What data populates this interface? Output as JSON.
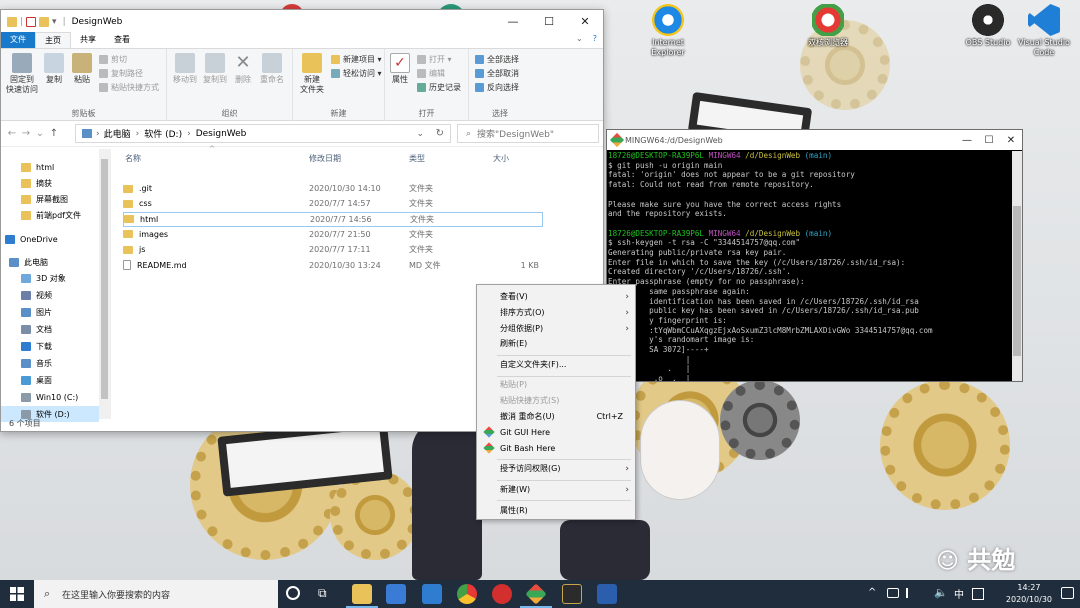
{
  "desktop": {
    "icons": [
      {
        "label": "Internet Explorer",
        "color": "#1e88e5"
      },
      {
        "label": "双核浏览器",
        "color": "#e53935"
      },
      {
        "label": "OBS Studio",
        "color": "#2a2a2a"
      },
      {
        "label": "Visual Studio Code",
        "color": "#1f7ed6"
      }
    ],
    "watermark": "共勉"
  },
  "explorer": {
    "title": "DesignWeb",
    "tabs": [
      "文件",
      "主页",
      "共享",
      "查看"
    ],
    "ribbon": {
      "clipboard": {
        "pin": "固定到\n快速访问",
        "copy": "复制",
        "paste": "粘贴",
        "cut": "剪切",
        "copy_path": "复制路径",
        "paste_shortcut": "粘贴快捷方式",
        "group": "剪贴板"
      },
      "organize": {
        "move_to": "移动到",
        "copy_to": "复制到",
        "delete": "删除",
        "rename": "重命名",
        "group": "组织"
      },
      "new": {
        "new_folder": "新建\n文件夹",
        "new_item": "新建项目 ▾",
        "easy_access": "轻松访问 ▾",
        "group": "新建"
      },
      "open": {
        "properties": "属性",
        "open": "打开 ▾",
        "edit": "编辑",
        "history": "历史记录",
        "group": "打开"
      },
      "select": {
        "select_all": "全部选择",
        "select_none": "全部取消",
        "invert": "反向选择",
        "group": "选择"
      }
    },
    "address": {
      "segments": [
        "此电脑",
        "软件 (D:)",
        "DesignWeb"
      ],
      "search_placeholder": "搜索\"DesignWeb\""
    },
    "nav": [
      {
        "label": "html",
        "kind": "folder"
      },
      {
        "label": "摘获",
        "kind": "folder"
      },
      {
        "label": "屏幕截图",
        "kind": "folder"
      },
      {
        "label": "前端pdf文件",
        "kind": "folder"
      },
      {
        "label": "OneDrive",
        "kind": "cloud"
      },
      {
        "label": "此电脑",
        "kind": "pc"
      },
      {
        "label": "3D 对象",
        "kind": "3d"
      },
      {
        "label": "视频",
        "kind": "video"
      },
      {
        "label": "图片",
        "kind": "pic"
      },
      {
        "label": "文档",
        "kind": "doc"
      },
      {
        "label": "下载",
        "kind": "down"
      },
      {
        "label": "音乐",
        "kind": "music"
      },
      {
        "label": "桌面",
        "kind": "desk"
      },
      {
        "label": "Win10 (C:)",
        "kind": "drive"
      },
      {
        "label": "软件 (D:)",
        "kind": "drive"
      }
    ],
    "columns": [
      "名称",
      "修改日期",
      "类型",
      "大小"
    ],
    "files": [
      {
        "name": ".git",
        "date": "2020/10/30 14:10",
        "type": "文件夹",
        "size": ""
      },
      {
        "name": "css",
        "date": "2020/7/7 14:57",
        "type": "文件夹",
        "size": ""
      },
      {
        "name": "html",
        "date": "2020/7/7 14:56",
        "type": "文件夹",
        "size": ""
      },
      {
        "name": "images",
        "date": "2020/7/7 21:50",
        "type": "文件夹",
        "size": ""
      },
      {
        "name": "js",
        "date": "2020/7/7 17:11",
        "type": "文件夹",
        "size": ""
      },
      {
        "name": "README.md",
        "date": "2020/10/30 13:24",
        "type": "MD 文件",
        "size": "1 KB"
      }
    ],
    "status": "6 个项目"
  },
  "terminal": {
    "title": "MINGW64:/d/DesignWeb",
    "lines": [
      [
        {
          "t": "18726@DESKTOP-RA39P6L ",
          "c": "tg"
        },
        {
          "t": "MINGW64 ",
          "c": "tm"
        },
        {
          "t": "/d/DesignWeb ",
          "c": "ty"
        },
        {
          "t": "(main)",
          "c": "tc"
        }
      ],
      [
        {
          "t": "$ git push -u origin main",
          "c": ""
        }
      ],
      [
        {
          "t": "fatal: 'origin' does not appear to be a git repository",
          "c": ""
        }
      ],
      [
        {
          "t": "fatal: Could not read from remote repository.",
          "c": ""
        }
      ],
      [
        {
          "t": "",
          "c": ""
        }
      ],
      [
        {
          "t": "Please make sure you have the correct access rights",
          "c": ""
        }
      ],
      [
        {
          "t": "and the repository exists.",
          "c": ""
        }
      ],
      [
        {
          "t": "",
          "c": ""
        }
      ],
      [
        {
          "t": "18726@DESKTOP-RA39P6L ",
          "c": "tg"
        },
        {
          "t": "MINGW64 ",
          "c": "tm"
        },
        {
          "t": "/d/DesignWeb ",
          "c": "ty"
        },
        {
          "t": "(main)",
          "c": "tc"
        }
      ],
      [
        {
          "t": "$ ssh-keygen -t rsa -C \"3344514757@qq.com\"",
          "c": ""
        }
      ],
      [
        {
          "t": "Generating public/private rsa key pair.",
          "c": ""
        }
      ],
      [
        {
          "t": "Enter file in which to save the key (/c/Users/18726/.ssh/id_rsa):",
          "c": ""
        }
      ],
      [
        {
          "t": "Created directory '/c/Users/18726/.ssh'.",
          "c": ""
        }
      ],
      [
        {
          "t": "Enter passphrase (empty for no passphrase):",
          "c": ""
        }
      ],
      [
        {
          "t": "         same passphrase again:",
          "c": ""
        }
      ],
      [
        {
          "t": "         identification has been saved in /c/Users/18726/.ssh/id_rsa",
          "c": ""
        }
      ],
      [
        {
          "t": "         public key has been saved in /c/Users/18726/.ssh/id_rsa.pub",
          "c": ""
        }
      ],
      [
        {
          "t": "         y fingerprint is:",
          "c": ""
        }
      ],
      [
        {
          "t": "         :tYqWbmCCuAXqgzEjxAoSxumZ3lcM8MrbZMLAXDivGWo 3344514757@qq.com",
          "c": ""
        }
      ],
      [
        {
          "t": "         y's randomart image is:",
          "c": ""
        }
      ],
      [
        {
          "t": "         SA 3072]----+",
          "c": ""
        }
      ],
      [
        {
          "t": "                 |",
          "c": ""
        }
      ],
      [
        {
          "t": "             .   |",
          "c": ""
        }
      ],
      [
        {
          "t": "          .o  .  |",
          "c": ""
        }
      ]
    ]
  },
  "context_menu": {
    "view": "查看(V)",
    "sort": "排序方式(O)",
    "group": "分组依据(P)",
    "refresh": "刷新(E)",
    "customize": "自定义文件夹(F)...",
    "paste": "粘贴(P)",
    "paste_shortcut": "粘贴快捷方式(S)",
    "undo_rename": "撤消 重命名(U)",
    "undo_shortcut": "Ctrl+Z",
    "git_gui": "Git GUI Here",
    "git_bash": "Git Bash Here",
    "grant_access": "授予访问权限(G)",
    "new": "新建(W)",
    "properties": "属性(R)"
  },
  "taskbar": {
    "search_placeholder": "在这里输入你要搜索的内容",
    "time": "14:27",
    "date": "2020/10/30",
    "lang": "中"
  }
}
